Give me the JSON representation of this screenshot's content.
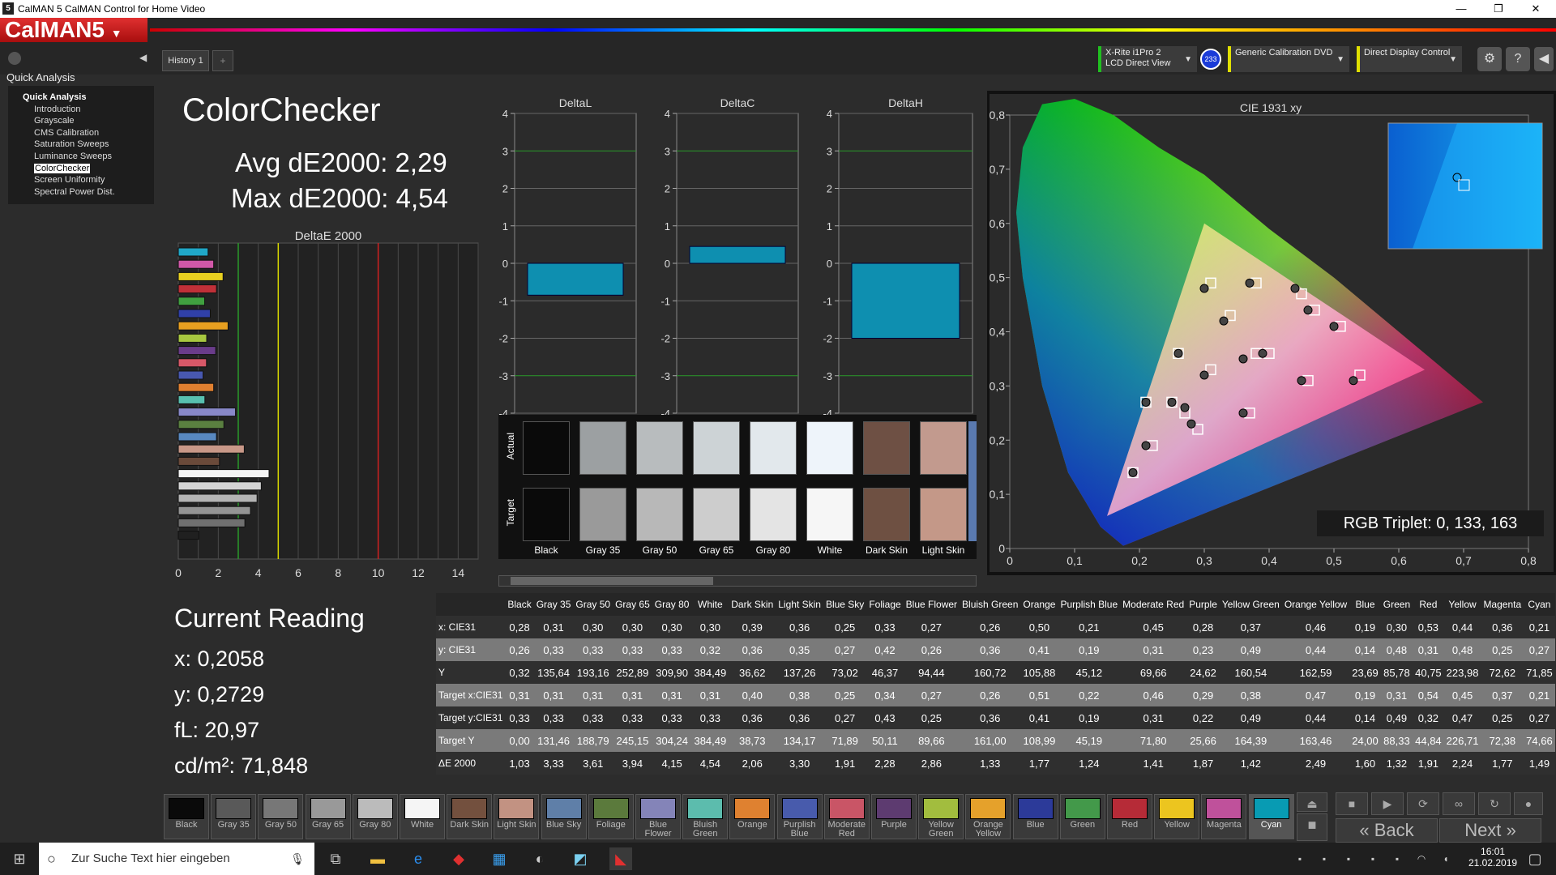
{
  "window": {
    "title": "CalMAN 5 CalMAN Control for Home Video",
    "app_icon": "5",
    "min": "—",
    "max": "❐",
    "close": "✕"
  },
  "logo": "CalMAN5",
  "tabs": {
    "history": "History 1",
    "add": "+"
  },
  "devices": [
    {
      "line1": "X-Rite i1Pro 2",
      "line2": "LCD Direct View"
    },
    {
      "badge": "233"
    },
    {
      "line1": "Generic Calibration DVD",
      "line2": ""
    },
    {
      "line1": "Direct Display Control",
      "line2": ""
    }
  ],
  "sidebar": {
    "header": "Quick Analysis",
    "group": "Quick Analysis",
    "items": [
      "Introduction",
      "Grayscale",
      "CMS Calibration",
      "Saturation Sweeps",
      "Luminance Sweeps",
      "ColorChecker",
      "Screen Uniformity",
      "Spectral Power Dist."
    ],
    "selected": "ColorChecker"
  },
  "summary": {
    "title": "ColorChecker",
    "avg": "Avg dE2000: 2,29",
    "max": "Max dE2000: 4,54"
  },
  "reading": {
    "title": "Current Reading",
    "x": "x: 0,2058",
    "y": "y: 0,2729",
    "fl": "fL: 20,97",
    "cd": "cd/m²: 71,848"
  },
  "rgb_triplet": "RGB Triplet: 0, 133, 163",
  "chart_data": [
    {
      "type": "bar",
      "title": "DeltaE 2000",
      "orientation": "horizontal",
      "xlim": [
        0,
        15
      ],
      "xticks": [
        "0",
        "2",
        "4",
        "6",
        "8",
        "10",
        "12",
        "14"
      ],
      "thresholds": [
        {
          "value": 3,
          "color": "#2a9a2a"
        },
        {
          "value": 5,
          "color": "#d8d800"
        },
        {
          "value": 10,
          "color": "#d02020"
        }
      ],
      "categories": [
        "Cyan",
        "Magenta",
        "Yellow",
        "Red",
        "Green",
        "Blue",
        "Orange Yellow",
        "Yellow Green",
        "Purple",
        "Moderate Red",
        "Purplish Blue",
        "Orange",
        "Bluish Green",
        "Blue Flower",
        "Foliage",
        "Blue Sky",
        "Light Skin",
        "Dark Skin",
        "White",
        "Gray 80",
        "Gray 65",
        "Gray 50",
        "Gray 35",
        "Black"
      ],
      "values": [
        1.49,
        1.77,
        2.24,
        1.91,
        1.32,
        1.6,
        2.49,
        1.42,
        1.87,
        1.41,
        1.24,
        1.77,
        1.33,
        2.86,
        2.28,
        1.91,
        3.3,
        2.06,
        4.54,
        4.15,
        3.94,
        3.61,
        3.33,
        1.03
      ],
      "colors": [
        "#20a8c8",
        "#d058a8",
        "#e8d020",
        "#c03038",
        "#40a040",
        "#3040a8",
        "#e8a020",
        "#a8c840",
        "#6a3c8a",
        "#d85868",
        "#4858b0",
        "#e08030",
        "#58c0b0",
        "#8888c8",
        "#5a8040",
        "#5888c0",
        "#c89888",
        "#6a4a3a",
        "#f4f4f4",
        "#d4d4d4",
        "#b4b4b4",
        "#949494",
        "#707070",
        "#202020"
      ]
    },
    {
      "type": "bar",
      "title": "DeltaL",
      "ylim": [
        -4,
        4
      ],
      "yticks": [
        "4",
        "3",
        "2",
        "1",
        "0",
        "-1",
        "-2",
        "-3",
        "-4"
      ],
      "values": [
        -0.85
      ]
    },
    {
      "type": "bar",
      "title": "DeltaC",
      "ylim": [
        -4,
        4
      ],
      "yticks": [
        "4",
        "3",
        "2",
        "1",
        "0",
        "-1",
        "-2",
        "-3",
        "-4"
      ],
      "values": [
        0.45
      ]
    },
    {
      "type": "bar",
      "title": "DeltaH",
      "ylim": [
        -4,
        4
      ],
      "yticks": [
        "4",
        "3",
        "2",
        "1",
        "0",
        "-1",
        "-2",
        "-3",
        "-4"
      ],
      "values": [
        -2.0
      ]
    },
    {
      "type": "scatter",
      "title": "CIE 1931 xy",
      "xlim": [
        0,
        0.8
      ],
      "ylim": [
        0,
        0.8
      ],
      "xticks": [
        "0",
        "0,1",
        "0,2",
        "0,3",
        "0,4",
        "0,5",
        "0,6",
        "0,7",
        "0,8"
      ],
      "yticks": [
        "0,8",
        "0,7",
        "0,6",
        "0,5",
        "0,4",
        "0,3",
        "0,2",
        "0,1",
        "0"
      ],
      "gamut": [
        [
          0.64,
          0.33
        ],
        [
          0.3,
          0.6
        ],
        [
          0.15,
          0.06
        ]
      ],
      "targets": [
        [
          0.31,
          0.33
        ],
        [
          0.4,
          0.36
        ],
        [
          0.38,
          0.36
        ],
        [
          0.25,
          0.27
        ],
        [
          0.34,
          0.43
        ],
        [
          0.27,
          0.25
        ],
        [
          0.26,
          0.36
        ],
        [
          0.51,
          0.41
        ],
        [
          0.22,
          0.19
        ],
        [
          0.46,
          0.31
        ],
        [
          0.29,
          0.22
        ],
        [
          0.38,
          0.49
        ],
        [
          0.47,
          0.44
        ],
        [
          0.19,
          0.14
        ],
        [
          0.31,
          0.49
        ],
        [
          0.54,
          0.32
        ],
        [
          0.45,
          0.47
        ],
        [
          0.37,
          0.25
        ],
        [
          0.21,
          0.27
        ]
      ],
      "measured": [
        [
          0.3,
          0.32
        ],
        [
          0.39,
          0.36
        ],
        [
          0.36,
          0.35
        ],
        [
          0.25,
          0.27
        ],
        [
          0.33,
          0.42
        ],
        [
          0.27,
          0.26
        ],
        [
          0.26,
          0.36
        ],
        [
          0.5,
          0.41
        ],
        [
          0.21,
          0.19
        ],
        [
          0.45,
          0.31
        ],
        [
          0.28,
          0.23
        ],
        [
          0.37,
          0.49
        ],
        [
          0.46,
          0.44
        ],
        [
          0.19,
          0.14
        ],
        [
          0.3,
          0.48
        ],
        [
          0.53,
          0.31
        ],
        [
          0.44,
          0.48
        ],
        [
          0.36,
          0.25
        ],
        [
          0.21,
          0.27
        ]
      ]
    }
  ],
  "swatches": {
    "actual_label": "Actual",
    "target_label": "Target",
    "items": [
      {
        "name": "Black",
        "actual": "#0a0a0a",
        "target": "#0a0a0a"
      },
      {
        "name": "Gray 35",
        "actual": "#9ca0a2",
        "target": "#9a9a9a"
      },
      {
        "name": "Gray 50",
        "actual": "#b8bcbe",
        "target": "#b8b8b8"
      },
      {
        "name": "Gray 65",
        "actual": "#cdd3d6",
        "target": "#cdcdcd"
      },
      {
        "name": "Gray 80",
        "actual": "#e2e8ec",
        "target": "#e4e4e4"
      },
      {
        "name": "White",
        "actual": "#eef4fa",
        "target": "#f6f6f6"
      },
      {
        "name": "Dark Skin",
        "actual": "#6e5044",
        "target": "#6e5042"
      },
      {
        "name": "Light Skin",
        "actual": "#c29a8e",
        "target": "#c49888"
      }
    ]
  },
  "table": {
    "headers": [
      "",
      "Black",
      "Gray 35",
      "Gray 50",
      "Gray 65",
      "Gray 80",
      "White",
      "Dark Skin",
      "Light Skin",
      "Blue Sky",
      "Foliage",
      "Blue Flower",
      "Bluish Green",
      "Orange",
      "Purplish Blue",
      "Moderate Red",
      "Purple",
      "Yellow Green",
      "Orange Yellow",
      "Blue",
      "Green",
      "Red",
      "Yellow",
      "Magenta",
      "Cyan"
    ],
    "rows": [
      [
        "x: CIE31",
        "0,28",
        "0,31",
        "0,30",
        "0,30",
        "0,30",
        "0,30",
        "0,39",
        "0,36",
        "0,25",
        "0,33",
        "0,27",
        "0,26",
        "0,50",
        "0,21",
        "0,45",
        "0,28",
        "0,37",
        "0,46",
        "0,19",
        "0,30",
        "0,53",
        "0,44",
        "0,36",
        "0,21"
      ],
      [
        "y: CIE31",
        "0,26",
        "0,33",
        "0,33",
        "0,33",
        "0,33",
        "0,32",
        "0,36",
        "0,35",
        "0,27",
        "0,42",
        "0,26",
        "0,36",
        "0,41",
        "0,19",
        "0,31",
        "0,23",
        "0,49",
        "0,44",
        "0,14",
        "0,48",
        "0,31",
        "0,48",
        "0,25",
        "0,27"
      ],
      [
        "Y",
        "0,32",
        "135,64",
        "193,16",
        "252,89",
        "309,90",
        "384,49",
        "36,62",
        "137,26",
        "73,02",
        "46,37",
        "94,44",
        "160,72",
        "105,88",
        "45,12",
        "69,66",
        "24,62",
        "160,54",
        "162,59",
        "23,69",
        "85,78",
        "40,75",
        "223,98",
        "72,62",
        "71,85"
      ],
      [
        "Target x:CIE31",
        "0,31",
        "0,31",
        "0,31",
        "0,31",
        "0,31",
        "0,31",
        "0,40",
        "0,38",
        "0,25",
        "0,34",
        "0,27",
        "0,26",
        "0,51",
        "0,22",
        "0,46",
        "0,29",
        "0,38",
        "0,47",
        "0,19",
        "0,31",
        "0,54",
        "0,45",
        "0,37",
        "0,21"
      ],
      [
        "Target y:CIE31",
        "0,33",
        "0,33",
        "0,33",
        "0,33",
        "0,33",
        "0,33",
        "0,36",
        "0,36",
        "0,27",
        "0,43",
        "0,25",
        "0,36",
        "0,41",
        "0,19",
        "0,31",
        "0,22",
        "0,49",
        "0,44",
        "0,14",
        "0,49",
        "0,32",
        "0,47",
        "0,25",
        "0,27"
      ],
      [
        "Target Y",
        "0,00",
        "131,46",
        "188,79",
        "245,15",
        "304,24",
        "384,49",
        "38,73",
        "134,17",
        "71,89",
        "50,11",
        "89,66",
        "161,00",
        "108,99",
        "45,19",
        "71,80",
        "25,66",
        "164,39",
        "163,46",
        "24,00",
        "88,33",
        "44,84",
        "226,71",
        "72,38",
        "74,66"
      ],
      [
        "ΔE 2000",
        "1,03",
        "3,33",
        "3,61",
        "3,94",
        "4,15",
        "4,54",
        "2,06",
        "3,30",
        "1,91",
        "2,28",
        "2,86",
        "1,33",
        "1,77",
        "1,24",
        "1,41",
        "1,87",
        "1,42",
        "2,49",
        "1,60",
        "1,32",
        "1,91",
        "2,24",
        "1,77",
        "1,49"
      ]
    ]
  },
  "bottom_swatches": [
    {
      "label": "Black",
      "color": "#0a0a0a"
    },
    {
      "label": "Gray 35",
      "color": "#595959"
    },
    {
      "label": "Gray 50",
      "color": "#777777"
    },
    {
      "label": "Gray 65",
      "color": "#999999"
    },
    {
      "label": "Gray 80",
      "color": "#bbbbbb"
    },
    {
      "label": "White",
      "color": "#f5f5f5"
    },
    {
      "label": "Dark Skin",
      "color": "#73503e"
    },
    {
      "label": "Light Skin",
      "color": "#c29282"
    },
    {
      "label": "Blue Sky",
      "color": "#5f7fa8"
    },
    {
      "label": "Foliage",
      "color": "#5b7a3c"
    },
    {
      "label": "Blue Flower",
      "color": "#8484b8"
    },
    {
      "label": "Bluish Green",
      "color": "#5cbcad"
    },
    {
      "label": "Orange",
      "color": "#df8130"
    },
    {
      "label": "Purplish Blue",
      "color": "#485bac"
    },
    {
      "label": "Moderate Red",
      "color": "#c95566"
    },
    {
      "label": "Purple",
      "color": "#5d3b70"
    },
    {
      "label": "Yellow Green",
      "color": "#a2bd3e"
    },
    {
      "label": "Orange Yellow",
      "color": "#e5a12b"
    },
    {
      "label": "Blue",
      "color": "#2c3a99"
    },
    {
      "label": "Green",
      "color": "#43994a"
    },
    {
      "label": "Red",
      "color": "#b62b37"
    },
    {
      "label": "Yellow",
      "color": "#ecc51f"
    },
    {
      "label": "Magenta",
      "color": "#bf519b"
    },
    {
      "label": "Cyan",
      "color": "#089bb3"
    }
  ],
  "nav": {
    "back": "Back",
    "next": "Next"
  },
  "taskbar": {
    "search": "Zur Suche Text hier eingeben",
    "time": "16:01",
    "date": "21.02.2019"
  }
}
